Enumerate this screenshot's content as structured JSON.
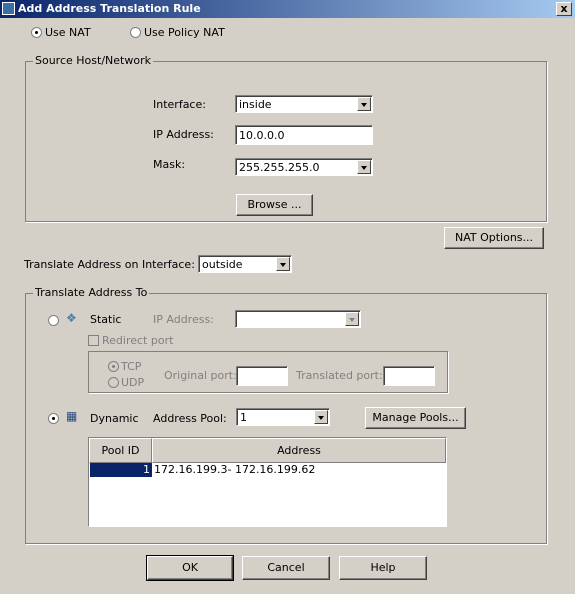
{
  "window": {
    "title": "Add Address Translation Rule",
    "close_label": "x"
  },
  "nat_mode": {
    "use_nat_label": "Use NAT",
    "use_policy_nat_label": "Use Policy NAT",
    "selected": "Use NAT"
  },
  "source": {
    "legend": "Source Host/Network",
    "interface_label": "Interface:",
    "interface_value": "inside",
    "ip_label": "IP Address:",
    "ip_value": "10.0.0.0",
    "mask_label": "Mask:",
    "mask_value": "255.255.255.0",
    "browse_label": "Browse ..."
  },
  "nat_options_label": "NAT Options...",
  "translate_interface": {
    "label": "Translate Address on Interface:",
    "value": "outside"
  },
  "translate_to": {
    "legend": "Translate Address To",
    "static_label": "Static",
    "static_ip_label": "IP Address:",
    "static_ip_value": "",
    "redirect_label": "Redirect port",
    "tcp_label": "TCP",
    "udp_label": "UDP",
    "original_port_label": "Original port:",
    "translated_port_label": "Translated port:",
    "dynamic_label": "Dynamic",
    "pool_label": "Address Pool:",
    "pool_value": "1",
    "manage_pools_label": "Manage Pools..."
  },
  "pool_table": {
    "columns": [
      "Pool ID",
      "Address"
    ],
    "rows": [
      {
        "pool_id": "1",
        "address": "172.16.199.3- 172.16.199.62"
      }
    ]
  },
  "footer": {
    "ok_label": "OK",
    "cancel_label": "Cancel",
    "help_label": "Help"
  }
}
